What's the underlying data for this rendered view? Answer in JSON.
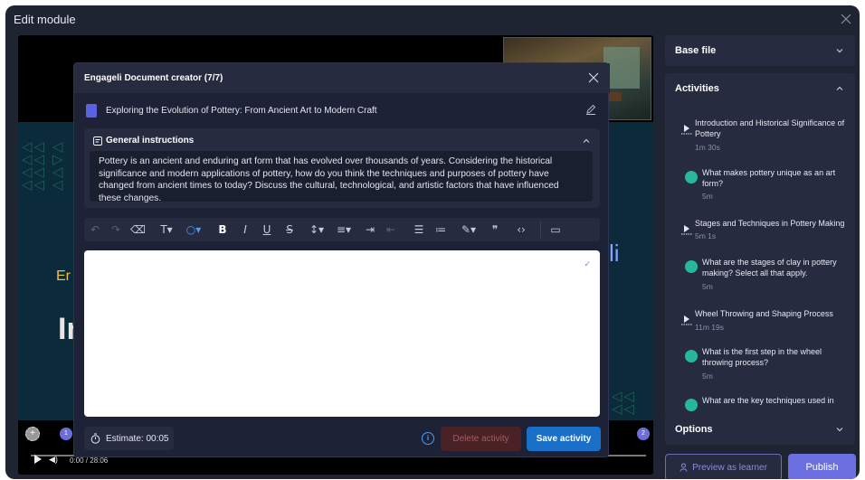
{
  "window": {
    "title": "Edit module"
  },
  "video": {
    "time": "0:00 / 28:06",
    "slide_big_text": "In",
    "slide_small_text": "Er",
    "slide_right_text": "li",
    "markers": [
      "1",
      "2"
    ]
  },
  "modal": {
    "title": "Engageli Document creator (7/7)",
    "document_title": "Exploring the Evolution of Pottery: From Ancient Art to Modern Craft",
    "general_instructions": {
      "label": "General instructions",
      "text": "Pottery is an ancient and enduring art form that has evolved over thousands of years. Considering the historical significance and modern applications of pottery, how do you think the techniques and purposes of pottery have changed from ancient times to today? Discuss the cultural, technological, and artistic factors that have influenced these changes."
    },
    "estimate": "Estimate: 00:05",
    "delete_label": "Delete activity",
    "save_label": "Save activity"
  },
  "panel": {
    "base_file": "Base file",
    "activities_label": "Activities",
    "options_label": "Options",
    "activities": [
      {
        "type": "video",
        "title": "Introduction and Historical Significance of Pottery",
        "duration": "1m 30s"
      },
      {
        "type": "poll",
        "title": "What makes pottery unique as an art form?",
        "duration": "5m"
      },
      {
        "type": "video",
        "title": "Stages and Techniques in Pottery Making",
        "duration": "5m 1s"
      },
      {
        "type": "poll",
        "title": "What are the stages of clay in pottery making? Select all that apply.",
        "duration": "5m"
      },
      {
        "type": "video",
        "title": "Wheel Throwing and Shaping Process",
        "duration": "11m 19s"
      },
      {
        "type": "poll",
        "title": "What is the first step in the wheel throwing process?",
        "duration": "5m"
      },
      {
        "type": "poll",
        "title": "What are the key techniques used in",
        "duration": ""
      }
    ],
    "preview_label": "Preview as learner",
    "publish_label": "Publish"
  },
  "colors": {
    "accent": "#6b6fe0",
    "save": "#1a6fc9",
    "poll_icon": "#27b89b"
  }
}
